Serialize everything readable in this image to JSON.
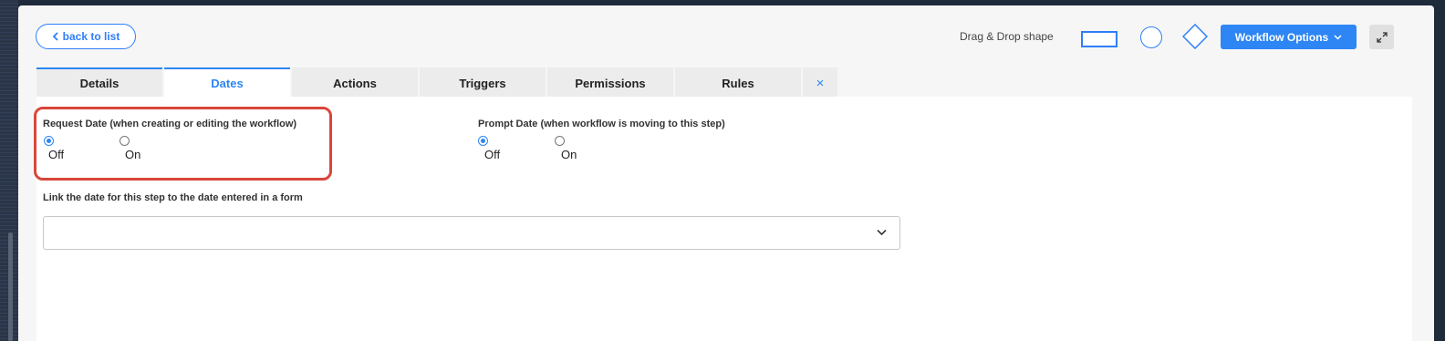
{
  "header": {
    "back_label": "back to list",
    "drag_drop_label": "Drag & Drop shape",
    "workflow_options_label": "Workflow Options"
  },
  "tabs": [
    {
      "label": "Details"
    },
    {
      "label": "Dates"
    },
    {
      "label": "Actions"
    },
    {
      "label": "Triggers"
    },
    {
      "label": "Permissions"
    },
    {
      "label": "Rules"
    },
    {
      "label": "×"
    }
  ],
  "active_tab": "Dates",
  "request_date": {
    "title": "Request Date (when creating or editing the workflow)",
    "options": [
      {
        "label": "Off",
        "checked": true
      },
      {
        "label": "On",
        "checked": false
      }
    ]
  },
  "prompt_date": {
    "title": "Prompt Date (when workflow is moving to this step)",
    "options": [
      {
        "label": "Off",
        "checked": true
      },
      {
        "label": "On",
        "checked": false
      }
    ]
  },
  "link_date": {
    "title": "Link the date for this step to the date entered in a form",
    "value": ""
  },
  "colors": {
    "accent": "#2d86f3",
    "highlight": "#d9463a"
  }
}
